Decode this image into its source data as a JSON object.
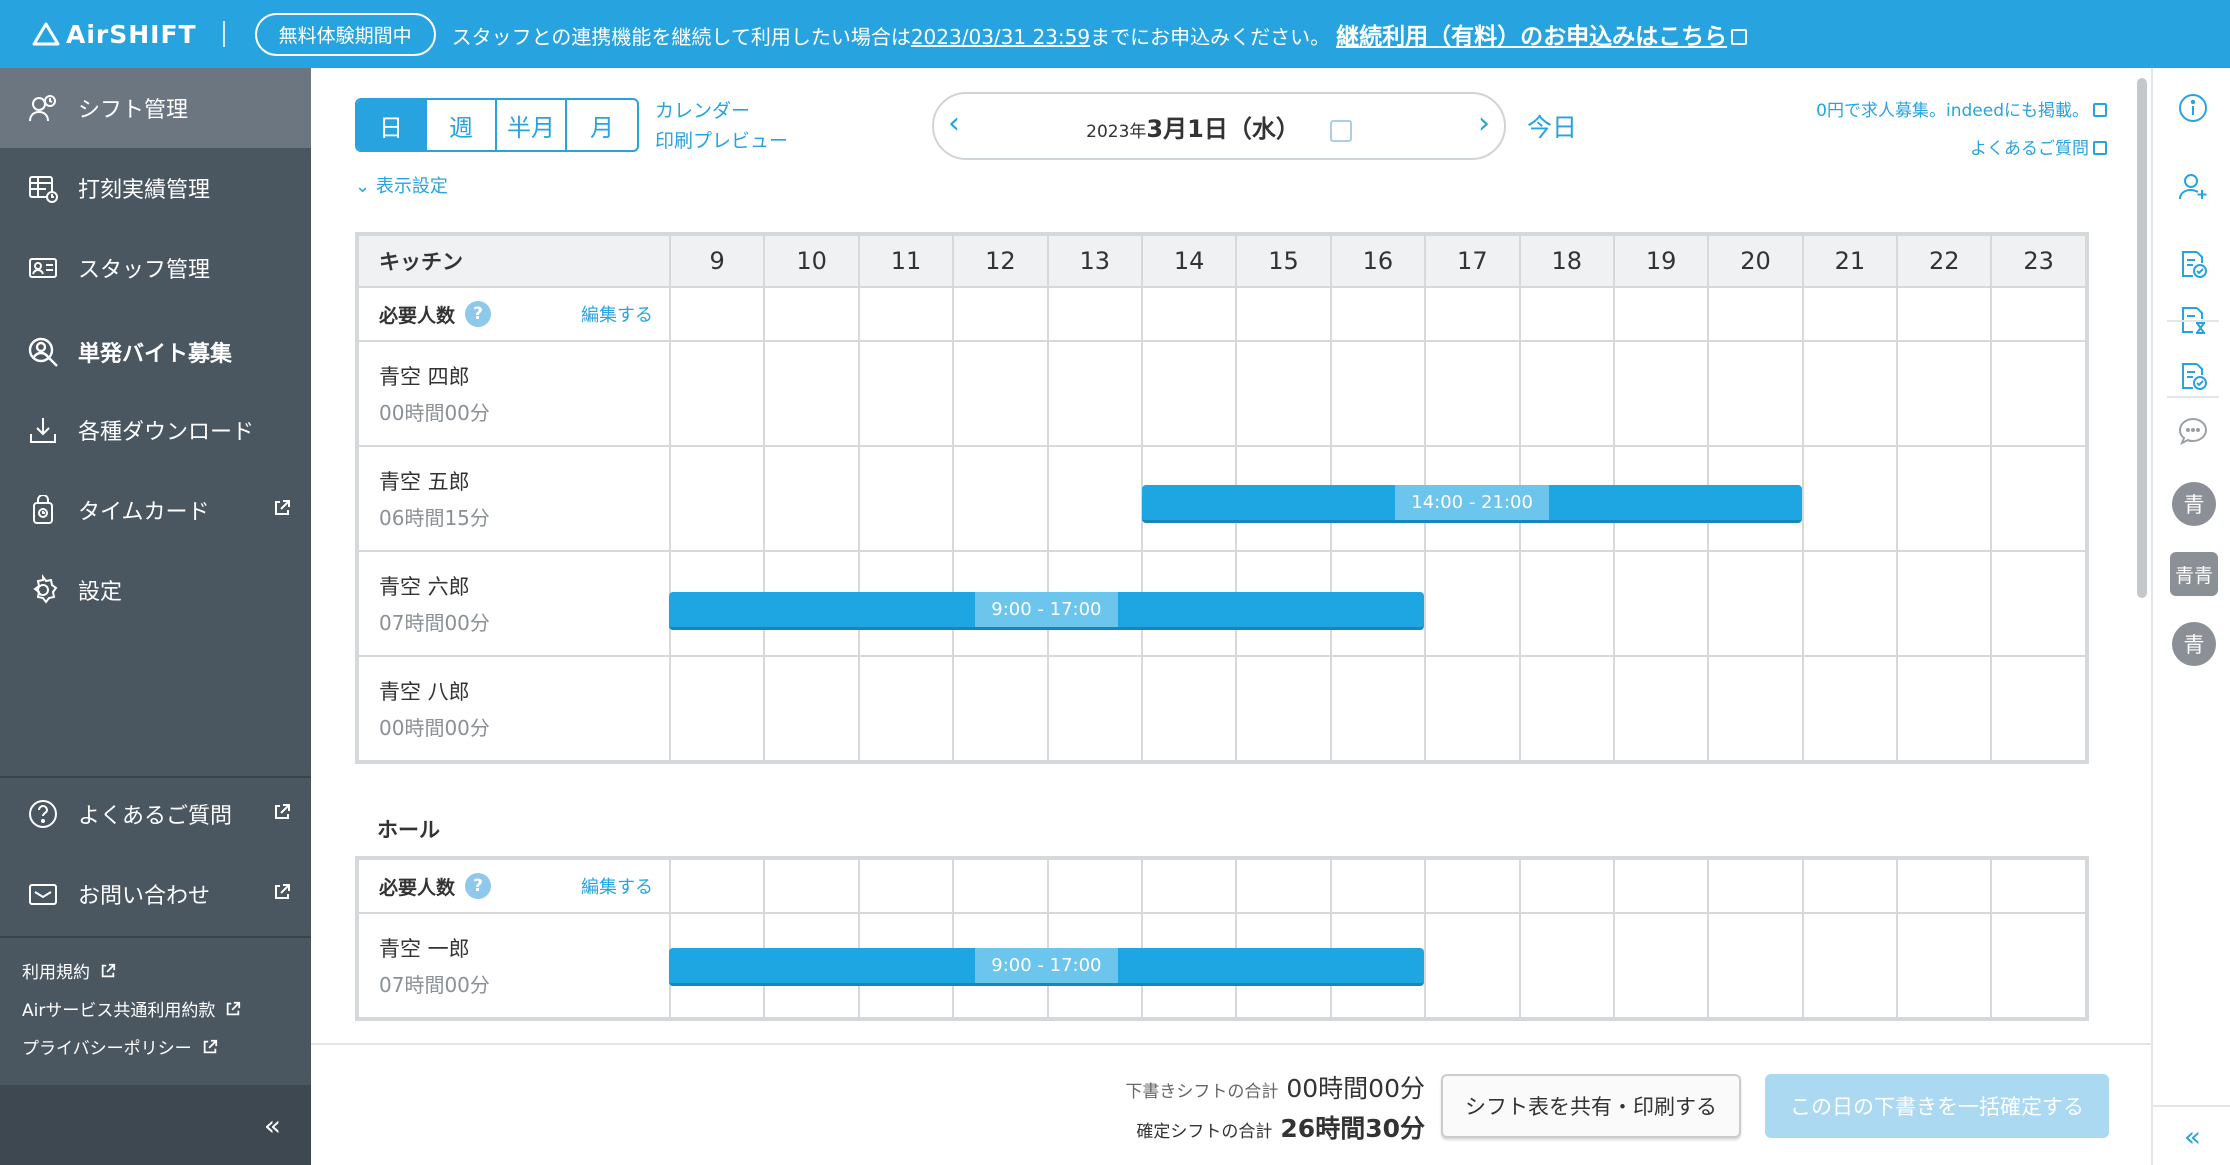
{
  "topbar": {
    "logo_text": "AirSHIFT",
    "trial_badge": "無料体験期間中",
    "notice_prefix": "スタッフとの連携機能を継続して利用したい場合は",
    "notice_deadline": "2023/03/31 23:59",
    "notice_suffix": "までにお申込みください。",
    "cta": "継続利用（有料）のお申込みはこちら"
  },
  "sidebar": {
    "items": [
      {
        "label": "シフト管理",
        "icon": "shift-icon"
      },
      {
        "label": "打刻実績管理",
        "icon": "timeclock-icon"
      },
      {
        "label": "スタッフ管理",
        "icon": "staff-card-icon"
      },
      {
        "label": "単発バイト募集",
        "icon": "recruit-icon"
      },
      {
        "label": "各種ダウンロード",
        "icon": "download-icon"
      },
      {
        "label": "タイムカード",
        "icon": "timecard-icon"
      },
      {
        "label": "設定",
        "icon": "gear-icon"
      }
    ],
    "help": "よくあるご質問",
    "contact": "お問い合わせ",
    "links": [
      "利用規約",
      "Airサービス共通利用約款",
      "プライバシーポリシー"
    ],
    "collapse": "«"
  },
  "toolbar": {
    "views": [
      "日",
      "週",
      "半月",
      "月"
    ],
    "calendar_link": "カレンダー",
    "print_link": "印刷プレビュー",
    "date_year": "2023年",
    "date_main": "3月1日（水）",
    "today": "今日",
    "recruit_link": "0円で求人募集。indeedにも掲載。",
    "faq_link": "よくあるご質問",
    "display_settings": "表示設定"
  },
  "hours": [
    "9",
    "10",
    "11",
    "12",
    "13",
    "14",
    "15",
    "16",
    "17",
    "18",
    "19",
    "20",
    "21",
    "22",
    "23"
  ],
  "sections": [
    {
      "name": "キッチン",
      "required_label": "必要人数",
      "edit_label": "編集する",
      "staff": [
        {
          "name": "青空 四郎",
          "hours": "00時間00分",
          "shift": null
        },
        {
          "name": "青空 五郎",
          "hours": "06時間15分",
          "shift": {
            "label": "14:00 - 21:00",
            "start": 14,
            "end": 21
          }
        },
        {
          "name": "青空 六郎",
          "hours": "07時間00分",
          "shift": {
            "label": "9:00 - 17:00",
            "start": 9,
            "end": 17
          }
        },
        {
          "name": "青空 八郎",
          "hours": "00時間00分",
          "shift": null
        }
      ]
    },
    {
      "name": "ホール",
      "required_label": "必要人数",
      "edit_label": "編集する",
      "staff": [
        {
          "name": "青空 一郎",
          "hours": "07時間00分",
          "shift": {
            "label": "9:00 - 17:00",
            "start": 9,
            "end": 17
          }
        }
      ]
    }
  ],
  "footer": {
    "draft_label": "下書きシフトの合計",
    "draft_value": "00時間00分",
    "confirmed_label": "確定シフトの合計",
    "confirmed_value": "26時間30分",
    "share_button": "シフト表を共有・印刷する",
    "confirm_button": "この日の下書きを一括確定する"
  },
  "rail": {
    "icons": [
      "info-icon",
      "add-staff-icon",
      "doc-check-icon",
      "doc-hourglass-icon",
      "doc-verified-icon",
      "chat-icon"
    ],
    "avatars": [
      "青",
      "青青",
      "青"
    ],
    "collapse": "«"
  },
  "colors": {
    "brand": "#27a4e0",
    "sidebar": "#4a5660",
    "shift_bar": "#1ea6e2"
  }
}
